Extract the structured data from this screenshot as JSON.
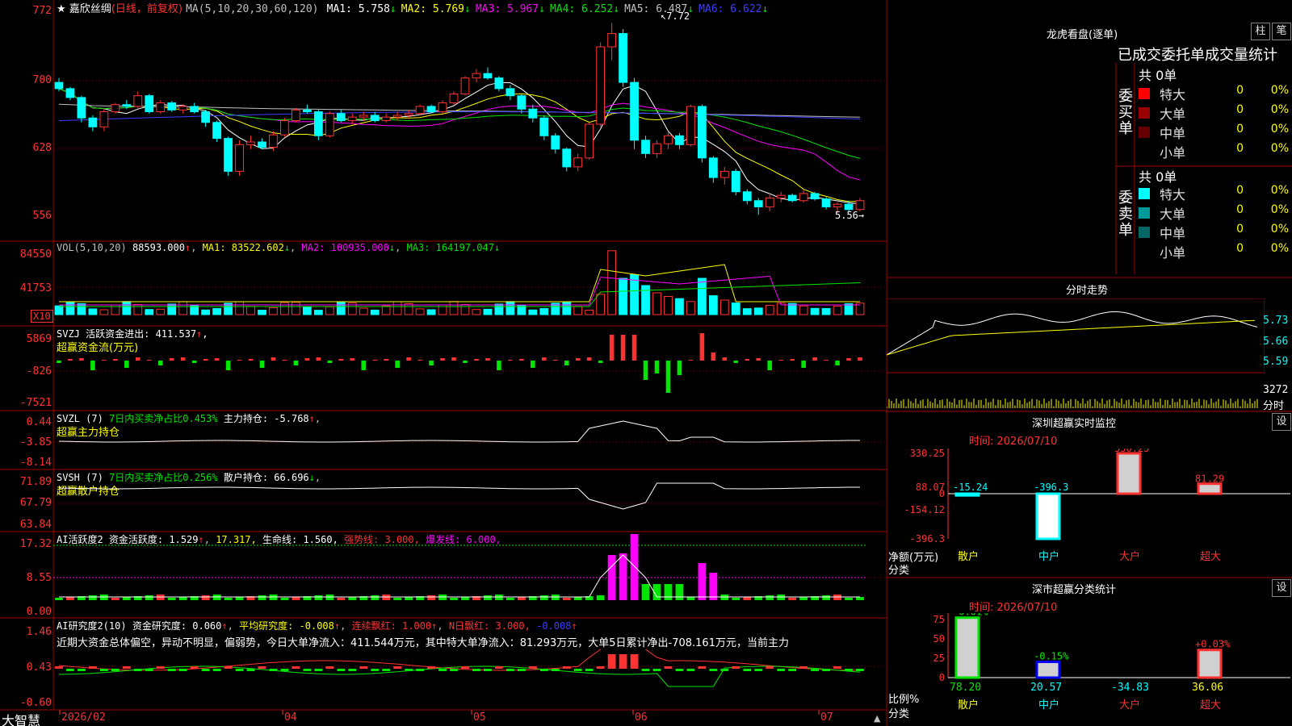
{
  "main": {
    "star": "★",
    "stock_name": "嘉欣丝绸",
    "period": "(日线，前复权)",
    "ma_title": "MA(5,10,20,30,60,120)",
    "ma_items": [
      {
        "label": "MA1:",
        "value": "5.758",
        "arrow": "↓",
        "color": "#ffffff"
      },
      {
        "label": "MA2:",
        "value": "5.769",
        "arrow": "↓",
        "color": "#ffff00"
      },
      {
        "label": "MA3:",
        "value": "5.967",
        "arrow": "↓",
        "color": "#ff00ff"
      },
      {
        "label": "MA4:",
        "value": "6.252",
        "arrow": "↓",
        "color": "#00e600"
      },
      {
        "label": "MA5:",
        "value": "6.487",
        "arrow": "↓",
        "color": "#c0c0c0"
      },
      {
        "label": "MA6:",
        "value": "6.622",
        "arrow": "↓",
        "color": "#3c3cff"
      }
    ],
    "y_labels": [
      "772",
      "700",
      "628",
      "556"
    ],
    "high_mark": "7.72",
    "low_mark": "5.56"
  },
  "vol": {
    "title": "VOL(5,10,20)",
    "value": "88593.000",
    "ma1": "MA1: 83522.602",
    "ma2": "MA2: 100935.000",
    "ma3": "MA3: 164197.047",
    "y_labels": [
      "84550",
      "41753"
    ],
    "unit": "X10"
  },
  "svzj": {
    "title": "SVZJ  活跃资金进出: 411.537",
    "subtitle": "超赢资金流(万元)",
    "y_labels": [
      "5869",
      "-826",
      "-7521"
    ]
  },
  "svzl": {
    "title": "SVZL  (7)",
    "ratio": "7日内买卖净占比0.453%",
    "hold": "主力持仓: -5.768",
    "subtitle": "超赢主力持仓",
    "y_labels": [
      "0.44",
      "-3.85",
      "-8.14"
    ]
  },
  "svsh": {
    "title": "SVSH  (7)",
    "ratio": "7日内买卖净占比0.256%",
    "hold": "散户持仓: 66.696",
    "subtitle": "超赢散户持仓",
    "y_labels": [
      "71.89",
      "67.79",
      "63.84"
    ]
  },
  "ai1": {
    "title": "AI活跃度2",
    "v1": "资金活跃度: 1.529",
    "v2": "17.317,",
    "v3": "生命线: 1.560,",
    "v4": "强势线: 3.000,",
    "v5": "爆发线: 6.000,",
    "y_labels": [
      "17.32",
      "8.55",
      "0.00"
    ]
  },
  "ai2": {
    "title": "AI研究度2(10)",
    "v1": "资金研究度: 0.060",
    "v2": "平均研究度: -0.008",
    "v3": "连续飘红: 1.000",
    "v4": "N日飘红: 3.000,",
    "v5": "-0.008",
    "comment": "近期大资金总体偏空，异动不明显，偏弱势，今日大单净流入：411.544万元，其中特大单净流入：81.293万元，大单5日累计净出-708.161万元，当前主力",
    "y_labels": [
      "1.46",
      "0.43",
      "-0.60"
    ]
  },
  "bottom": {
    "logo": "大智慧",
    "dates": [
      "2026/02",
      "04",
      "05",
      "06",
      "07"
    ]
  },
  "right": {
    "lhb_title": "龙虎看盘(逐单)",
    "btn_col": "柱",
    "btn_bi": "笔",
    "stat_title": "已成交委托单成交量统计",
    "buy_label": "委买单",
    "sell_label": "委卖单",
    "buy_total": "共 0单",
    "sell_total": "共 0单",
    "buy_rows": [
      {
        "name": "特大",
        "v": "0",
        "p": "0%",
        "color": "#ff0000"
      },
      {
        "name": "大单",
        "v": "0",
        "p": "0%",
        "color": "#990000"
      },
      {
        "name": "中单",
        "v": "0",
        "p": "0%",
        "color": "#660000"
      },
      {
        "name": "小单",
        "v": "0",
        "p": "0%",
        "color": "#000000"
      }
    ],
    "sell_rows": [
      {
        "name": "特大",
        "v": "0",
        "p": "0%",
        "color": "#00ffff"
      },
      {
        "name": "大单",
        "v": "0",
        "p": "0%",
        "color": "#009999"
      },
      {
        "name": "中单",
        "v": "0",
        "p": "0%",
        "color": "#006666"
      },
      {
        "name": "小单",
        "v": "0",
        "p": "0%",
        "color": "#000000"
      }
    ],
    "intraday_title": "分时走势",
    "intraday_y": [
      "5.73",
      "5.66",
      "5.59"
    ],
    "intraday_vol": "3272",
    "intraday_btn": "分时",
    "sz_title": "深圳超赢实时监控",
    "sz_btn": "设",
    "sz_time": "时间: 2026/07/10",
    "sz_y": [
      "330.25",
      "88.07",
      "0",
      "-154.12",
      "-396.3"
    ],
    "sz_axis": "净额(万元)",
    "sz_cat_label": "分类",
    "sz_cats": [
      "散户",
      "中户",
      "大户",
      "超大"
    ],
    "sz_vals": [
      "-15.24",
      "-396.3",
      "330.25",
      "81.29"
    ],
    "sc_title": "深市超赢分类统计",
    "sc_btn": "设",
    "sc_time": "时间: 2026/07/10",
    "sc_y": [
      "75",
      "50",
      "25",
      "0"
    ],
    "sc_axis": "比例%",
    "sc_cat_label": "分类",
    "sc_cats": [
      "散户",
      "中户",
      "大户",
      "超大"
    ],
    "sc_pct": [
      "-0.01%",
      "-0.15%",
      "",
      "+0.03%"
    ],
    "sc_vals": [
      "78.20",
      "20.57",
      "-34.83",
      "36.06"
    ]
  },
  "chart_data": {
    "type": "candlestick",
    "ylim": [
      5.4,
      7.85
    ],
    "ohlc": [
      [
        7.05,
        7.1,
        6.95,
        6.98
      ],
      [
        6.98,
        7.0,
        6.85,
        6.88
      ],
      [
        6.88,
        6.9,
        6.6,
        6.65
      ],
      [
        6.65,
        6.68,
        6.5,
        6.55
      ],
      [
        6.55,
        6.75,
        6.5,
        6.72
      ],
      [
        6.72,
        6.82,
        6.7,
        6.8
      ],
      [
        6.8,
        6.85,
        6.75,
        6.78
      ],
      [
        6.78,
        6.95,
        6.76,
        6.9
      ],
      [
        6.9,
        6.92,
        6.7,
        6.72
      ],
      [
        6.72,
        6.85,
        6.7,
        6.82
      ],
      [
        6.82,
        6.84,
        6.72,
        6.74
      ],
      [
        6.74,
        6.8,
        6.7,
        6.78
      ],
      [
        6.78,
        6.82,
        6.7,
        6.72
      ],
      [
        6.72,
        6.74,
        6.55,
        6.6
      ],
      [
        6.6,
        6.62,
        6.38,
        6.42
      ],
      [
        6.42,
        6.44,
        6.0,
        6.05
      ],
      [
        6.05,
        6.4,
        6.0,
        6.35
      ],
      [
        6.35,
        6.45,
        6.3,
        6.38
      ],
      [
        6.38,
        6.42,
        6.3,
        6.32
      ],
      [
        6.32,
        6.5,
        6.28,
        6.46
      ],
      [
        6.46,
        6.65,
        6.44,
        6.62
      ],
      [
        6.62,
        6.76,
        6.6,
        6.74
      ],
      [
        6.74,
        6.8,
        6.7,
        6.72
      ],
      [
        6.72,
        6.74,
        6.4,
        6.45
      ],
      [
        6.45,
        6.72,
        6.43,
        6.7
      ],
      [
        6.7,
        6.74,
        6.6,
        6.62
      ],
      [
        6.62,
        6.7,
        6.58,
        6.66
      ],
      [
        6.66,
        6.72,
        6.62,
        6.68
      ],
      [
        6.68,
        6.72,
        6.6,
        6.62
      ],
      [
        6.62,
        6.7,
        6.6,
        6.66
      ],
      [
        6.66,
        6.72,
        6.62,
        6.68
      ],
      [
        6.68,
        6.74,
        6.64,
        6.7
      ],
      [
        6.7,
        6.8,
        6.68,
        6.78
      ],
      [
        6.78,
        6.8,
        6.7,
        6.72
      ],
      [
        6.72,
        6.85,
        6.7,
        6.82
      ],
      [
        6.82,
        6.95,
        6.8,
        6.92
      ],
      [
        6.92,
        7.12,
        6.9,
        7.1
      ],
      [
        7.1,
        7.2,
        7.05,
        7.15
      ],
      [
        7.15,
        7.22,
        7.08,
        7.1
      ],
      [
        7.1,
        7.12,
        6.95,
        6.98
      ],
      [
        6.98,
        7.02,
        6.85,
        6.9
      ],
      [
        6.9,
        6.92,
        6.7,
        6.75
      ],
      [
        6.75,
        6.8,
        6.6,
        6.65
      ],
      [
        6.65,
        6.68,
        6.4,
        6.45
      ],
      [
        6.45,
        6.48,
        6.25,
        6.3
      ],
      [
        6.3,
        6.32,
        6.05,
        6.1
      ],
      [
        6.1,
        6.25,
        6.05,
        6.2
      ],
      [
        6.2,
        6.6,
        6.18,
        6.58
      ],
      [
        6.58,
        7.5,
        6.55,
        7.45
      ],
      [
        7.45,
        7.72,
        7.3,
        7.6
      ],
      [
        7.6,
        7.65,
        7.0,
        7.05
      ],
      [
        7.05,
        7.1,
        6.3,
        6.4
      ],
      [
        6.4,
        6.45,
        6.2,
        6.25
      ],
      [
        6.25,
        6.4,
        6.2,
        6.36
      ],
      [
        6.36,
        6.5,
        6.3,
        6.45
      ],
      [
        6.45,
        6.48,
        6.3,
        6.35
      ],
      [
        6.35,
        6.8,
        6.33,
        6.78
      ],
      [
        6.78,
        6.8,
        6.15,
        6.2
      ],
      [
        6.2,
        6.22,
        5.92,
        5.98
      ],
      [
        5.98,
        6.1,
        5.9,
        6.05
      ],
      [
        6.05,
        6.08,
        5.78,
        5.82
      ],
      [
        5.82,
        5.85,
        5.68,
        5.72
      ],
      [
        5.72,
        5.75,
        5.56,
        5.65
      ],
      [
        5.65,
        5.8,
        5.6,
        5.75
      ],
      [
        5.75,
        5.82,
        5.7,
        5.78
      ],
      [
        5.78,
        5.8,
        5.7,
        5.72
      ],
      [
        5.72,
        5.85,
        5.7,
        5.8
      ],
      [
        5.8,
        5.82,
        5.72,
        5.74
      ],
      [
        5.74,
        5.76,
        5.62,
        5.65
      ],
      [
        5.65,
        5.7,
        5.58,
        5.68
      ],
      [
        5.68,
        5.72,
        5.6,
        5.62
      ],
      [
        5.62,
        5.75,
        5.6,
        5.72
      ]
    ]
  }
}
